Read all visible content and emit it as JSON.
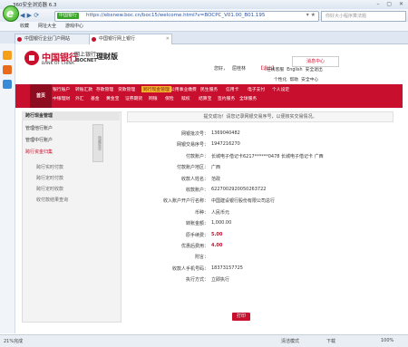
{
  "browser": {
    "title": "360安全浏览器 6.3",
    "url": "https://ebsnew.boc.cn/boc15/welcome.html?v=BOCPC_V01.00_B01.195",
    "secure_label": "中国银行",
    "search_placeholder": "在此处搜索",
    "search_text": "你好大小程序算法题",
    "favorites": [
      "收藏",
      "网址大全",
      "游戏中心"
    ],
    "tabs": [
      "中国银行企业门户网站",
      "中国银行网上银行"
    ],
    "status_left": "21%完成",
    "status_right_1": "清洁模式",
    "status_right_2": "下载",
    "status_right_3": "100%"
  },
  "bank": {
    "name_cn": "中国银行",
    "name_en": "BANK OF CHINA",
    "netbank": "网上银行",
    "bocnet": "BOCNET",
    "product": "理财版",
    "hello": "您好，",
    "username": "屈桂林",
    "logout": "【退出】",
    "msg_center": "消息中心",
    "hdr_links": [
      "在线客服",
      "English",
      "安全退出"
    ],
    "hdr_links2": [
      "个性化",
      "帮助",
      "安全中心"
    ],
    "home": "首页"
  },
  "nav": {
    "row1": [
      "银行账户",
      "转账汇款",
      "存款管理",
      "贷款管理",
      "跨行现金管理",
      "公用事业缴费",
      "民生服务",
      "信用卡",
      "电子支付",
      "个人设定"
    ],
    "row2": [
      "中银理财",
      "外汇",
      "基金",
      "黄金宝",
      "证券期货",
      "网银",
      "保险",
      "赎权",
      "结算宝",
      "签约服务",
      "全球服务"
    ],
    "selected_index": 4
  },
  "sidebar": {
    "title": "跨行现金管理",
    "collapse_label": "隐藏菜单",
    "items": [
      {
        "label": "管理他行账户",
        "sub": false
      },
      {
        "label": "管理中行账户",
        "sub": false
      },
      {
        "label": "跨行资金归集",
        "sub": false,
        "hl": true
      },
      {
        "label": "跨行实时付款",
        "sub": true
      },
      {
        "label": "跨行定时付款",
        "sub": true
      },
      {
        "label": "跨行定时收款",
        "sub": true
      },
      {
        "label": "收付款结果查询",
        "sub": true
      }
    ]
  },
  "main": {
    "notice": "提交成功！请您记录网银交易序号，以便核实交易情况。",
    "rows": [
      {
        "label": "网银批次号：",
        "value": "1369040482"
      },
      {
        "label": "网银交易序号：",
        "value": "1947216270"
      },
      {
        "label": "付款账户：",
        "value": "长城电子借记卡6217******0478 长城电子借记卡 广西"
      },
      {
        "label": "付款账户地区：",
        "value": "广西"
      },
      {
        "label": "收款人姓名：",
        "value": "范政"
      },
      {
        "label": "收款账户：",
        "value": "6227002920050263722"
      },
      {
        "label": "收入账户开户行名称：",
        "value": "中国建设银行股份有限公司总行"
      },
      {
        "label": "币种：",
        "value": "人民币元"
      },
      {
        "label": "转账金额：",
        "value": "1,000.00"
      },
      {
        "label": "原手续费：",
        "value": "5.00",
        "red": true
      },
      {
        "label": "优惠后费用：",
        "value": "4.00",
        "red": true
      },
      {
        "label": "附言：",
        "value": ""
      },
      {
        "label": "收款人手机号码：",
        "value": "18373157725"
      },
      {
        "label": "执行方式：",
        "value": "立即执行"
      }
    ],
    "print_button": "打印"
  }
}
